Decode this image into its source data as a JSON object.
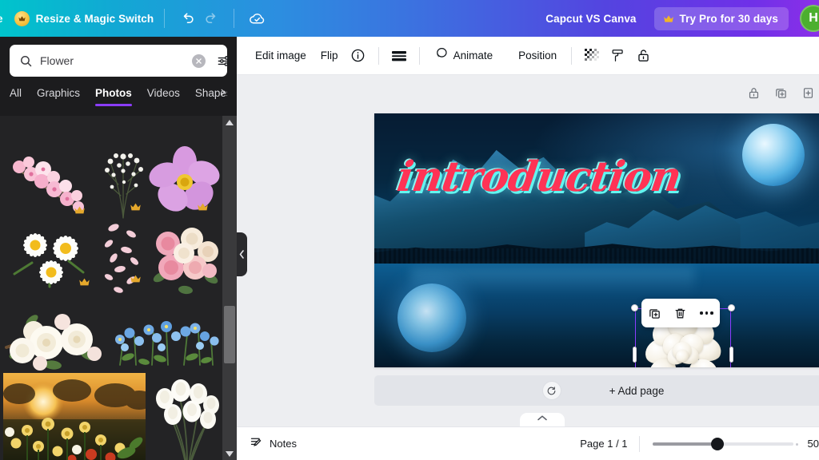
{
  "topbar": {
    "cut_text": "e",
    "resize_label": "Resize & Magic Switch",
    "undo_icon": "undo-icon",
    "redo_icon": "redo-icon",
    "cloud_icon": "cloud-saved-icon",
    "capcut_label": "Capcut VS Canva",
    "trypro_label": "Try Pro for 30 days",
    "avatar_initial": "H",
    "avatar_color": "#4caf2f",
    "gradient_start": "#00c4cc",
    "gradient_end": "#8b2fe8"
  },
  "sidebar": {
    "search": {
      "value": "Flower",
      "placeholder": "Search",
      "icon": "search-icon",
      "clear_icon": "clear-icon",
      "filter_icon": "filter-sliders-icon"
    },
    "tabs": [
      {
        "label": "All",
        "active": false
      },
      {
        "label": "Graphics",
        "active": false
      },
      {
        "label": "Photos",
        "active": true
      },
      {
        "label": "Videos",
        "active": false
      },
      {
        "label": "Shapes",
        "active": false
      }
    ],
    "tabs_more_icon": "chevron-right-icon",
    "active_tab_underline": "#8b3dff",
    "results": [
      {
        "name": "pink-cherry-blossom-branch",
        "pro": true
      },
      {
        "name": "babys-breath-sprig",
        "pro": true
      },
      {
        "name": "pink-cosmos-flower",
        "pro": true
      },
      {
        "name": "white-daisies-bunch",
        "pro": true
      },
      {
        "name": "falling-pink-petals",
        "pro": true
      },
      {
        "name": "pink-cream-roses-cluster",
        "pro": false
      },
      {
        "name": "white-roses-arrangement",
        "pro": false
      },
      {
        "name": "blue-forget-me-nots-row",
        "pro": false
      },
      {
        "name": "sunset-wildflower-field-photo",
        "pro": false
      },
      {
        "name": "white-tulips-on-dark-photo",
        "pro": false
      }
    ],
    "scrollbar": {
      "up_icon": "scroll-up-arrow-icon",
      "down_icon": "scroll-down-arrow-icon"
    },
    "collapse_icon": "collapse-panel-chevron-icon",
    "background": "#1c1c1e"
  },
  "toolbar": {
    "edit_image_label": "Edit image",
    "flip_label": "Flip",
    "info_icon": "info-icon",
    "bars_icon": "transparency-bars-icon",
    "animate_label": "Animate",
    "animate_icon": "animate-circle-icon",
    "position_label": "Position",
    "transparency_icon": "transparency-checker-icon",
    "paint_roller_icon": "paint-roller-icon",
    "lock_icon": "unlocked-padlock-icon"
  },
  "canvas_tools": {
    "lock_icon": "lock-page-icon",
    "duplicate_icon": "duplicate-page-icon",
    "addpage_icon": "add-page-icon"
  },
  "canvas": {
    "headline_text": "introduction",
    "headline_color": "#ff3355",
    "headline_glow_color": "#62f5f0",
    "background_name": "moonlit-mountain-lake-photo",
    "selected_element": "white-gardenia-flower",
    "selection_color": "#8b3dff",
    "context_toolbar": {
      "duplicate_icon": "duplicate-icon",
      "delete_icon": "trash-icon",
      "more_icon": "more-options-icon"
    }
  },
  "addpage": {
    "sync_icon": "sync-refresh-icon",
    "label": "+ Add page"
  },
  "bottombar": {
    "notes_icon": "notes-icon",
    "notes_label": "Notes",
    "page_count": "Page 1 / 1",
    "zoom_value": "50",
    "zoom_percent": 50,
    "collapse_icon": "chevron-up-icon"
  }
}
